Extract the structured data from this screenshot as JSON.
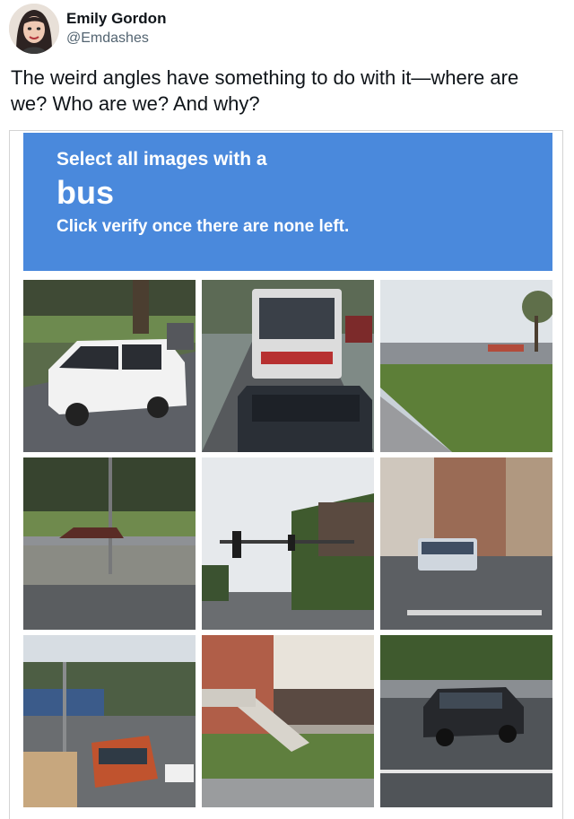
{
  "tweet": {
    "display_name": "Emily Gordon",
    "handle": "@Emdashes",
    "text": "The weird angles have something to do with it—where are we? Who are we? And why?"
  },
  "captcha": {
    "instruction_line1": "Select all images with a",
    "target_object": "bus",
    "instruction_line3": "Click verify once there are none left.",
    "banner_color": "#4a89dc",
    "tiles": [
      {
        "subject": "white minivan on street"
      },
      {
        "subject": "bus rear on road with car"
      },
      {
        "subject": "empty road and grass"
      },
      {
        "subject": "highway with concrete barrier"
      },
      {
        "subject": "traffic light and trees"
      },
      {
        "subject": "city street with bus and buildings"
      },
      {
        "subject": "street with red bus"
      },
      {
        "subject": "brick house with stairs"
      },
      {
        "subject": "dark SUV on road"
      }
    ]
  }
}
